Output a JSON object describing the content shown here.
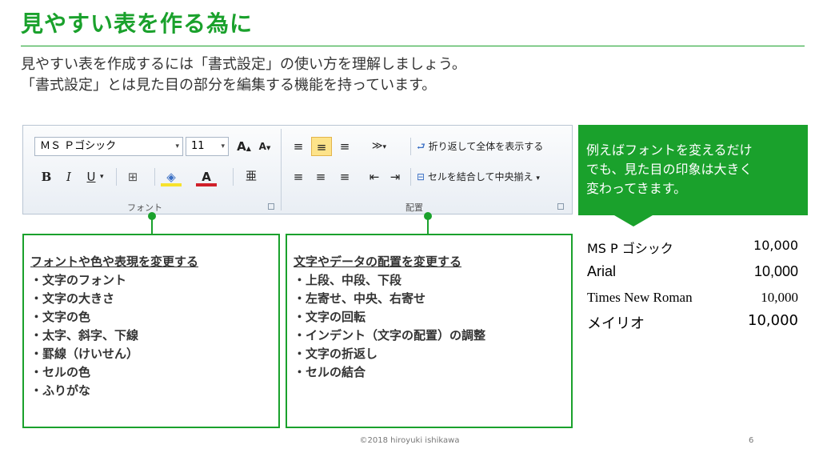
{
  "title": "見やすい表を作る為に",
  "intro": {
    "line1": "見やすい表を作成するには「書式設定」の使い方を理解しましょう。",
    "line2": "「書式設定」とは見た目の部分を編集する機能を持っています。"
  },
  "ribbon": {
    "font_group": {
      "label": "フォント",
      "font_name": "ＭＳ Ｐゴシック",
      "font_size": "11",
      "grow_label": "A",
      "shrink_label": "A",
      "bold": "B",
      "italic": "I",
      "underline": "U",
      "border_glyph": "⊞",
      "fill_glyph": "◈",
      "font_color_label": "A",
      "phonetic_glyph": "亜"
    },
    "align_group": {
      "label": "配置",
      "wrap_text": "折り返して全体を表示する",
      "merge_center": "セルを結合して中央揃え"
    },
    "dropdown_glyph": "▾",
    "launcher_glyph": "↘"
  },
  "font_box": {
    "heading": "フォントや色や表現を変更する",
    "items": [
      "・文字のフォント",
      "・文字の大きさ",
      "・文字の色",
      "・太字、斜字、下線",
      "・罫線（けいせん）",
      "・セルの色",
      "・ふりがな"
    ]
  },
  "align_box": {
    "heading": "文字やデータの配置を変更する",
    "items": [
      "・上段、中段、下段",
      "・左寄せ、中央、右寄せ",
      "・文字の回転",
      "・インデント（文字の配置）の調整",
      "・文字の折返し",
      "・セルの結合"
    ]
  },
  "callout": {
    "line1": "例えばフォントを変えるだけ",
    "line2": "でも、見た目の印象は大きく",
    "line3": "変わってきます。"
  },
  "font_samples": [
    {
      "name": "MS P ゴシック",
      "value": "10,000"
    },
    {
      "name": "Arial",
      "value": "10,000"
    },
    {
      "name": "Times New Roman",
      "value": "10,000"
    },
    {
      "name": "メイリオ",
      "value": "10,000"
    }
  ],
  "footer": "©2018 hiroyuki ishikawa",
  "page_number": "6",
  "colors": {
    "accent": "#1aa12c",
    "highlight": "#fde38a"
  }
}
